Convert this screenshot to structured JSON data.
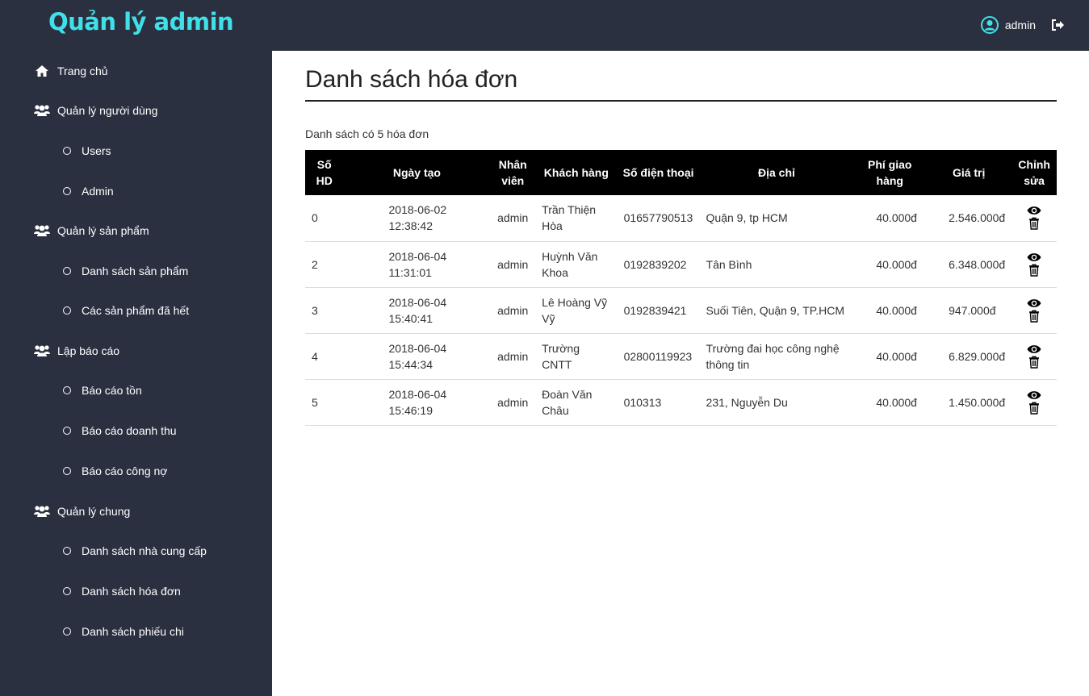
{
  "header": {
    "brand": "Quản lý admin",
    "username": "admin"
  },
  "sidebar": {
    "items": [
      {
        "label": "Trang chủ",
        "icon": "home-icon"
      },
      {
        "label": "Quản lý người dùng",
        "icon": "users-icon",
        "children": [
          "Users",
          "Admin"
        ]
      },
      {
        "label": "Quản lý sản phẩm",
        "icon": "users-icon",
        "children": [
          "Danh sách sản phẩm",
          "Các sản phẩm đã hết"
        ]
      },
      {
        "label": "Lập báo cáo",
        "icon": "users-icon",
        "children": [
          "Báo cáo tồn",
          "Báo cáo doanh thu",
          "Báo cáo công nợ"
        ]
      },
      {
        "label": "Quản lý chung",
        "icon": "users-icon",
        "children": [
          "Danh sách nhà cung cấp",
          "Danh sách hóa đơn",
          "Danh sách phiếu chi"
        ]
      }
    ]
  },
  "main": {
    "title": "Danh sách hóa đơn",
    "count_text": "Danh sách có 5 hóa đơn",
    "columns": [
      "Số HD",
      "Ngày tạo",
      "Nhân viên",
      "Khách hàng",
      "Số điện thoại",
      "Địa chỉ",
      "Phí giao hàng",
      "Giá trị",
      "Chỉnh sửa"
    ],
    "rows": [
      {
        "id": "0",
        "date": "2018-06-02 12:38:42",
        "staff": "admin",
        "customer": "Trần Thiện Hòa",
        "phone": "01657790513",
        "address": "Quận 9, tp HCM",
        "fee": "40.000đ",
        "value": "2.546.000đ"
      },
      {
        "id": "2",
        "date": "2018-06-04 11:31:01",
        "staff": "admin",
        "customer": "Huỳnh Văn Khoa",
        "phone": "0192839202",
        "address": "Tân Bình",
        "fee": "40.000đ",
        "value": "6.348.000đ"
      },
      {
        "id": "3",
        "date": "2018-06-04 15:40:41",
        "staff": "admin",
        "customer": "Lê Hoàng Vỹ Vỹ",
        "phone": "0192839421",
        "address": "Suối Tiên, Quận 9, TP.HCM",
        "fee": "40.000đ",
        "value": "947.000đ"
      },
      {
        "id": "4",
        "date": "2018-06-04 15:44:34",
        "staff": "admin",
        "customer": "Trường CNTT",
        "phone": "02800119923",
        "address": "Trường đai học công nghệ thông tin",
        "fee": "40.000đ",
        "value": "6.829.000đ"
      },
      {
        "id": "5",
        "date": "2018-06-04 15:46:19",
        "staff": "admin",
        "customer": "Đoàn Văn Châu",
        "phone": "010313",
        "address": "231, Nguyễn Du",
        "fee": "40.000đ",
        "value": "1.450.000đ"
      }
    ]
  },
  "colors": {
    "sidebar_bg": "#2b3041",
    "brand": "#3fe0e8",
    "table_header_bg": "#000000"
  }
}
